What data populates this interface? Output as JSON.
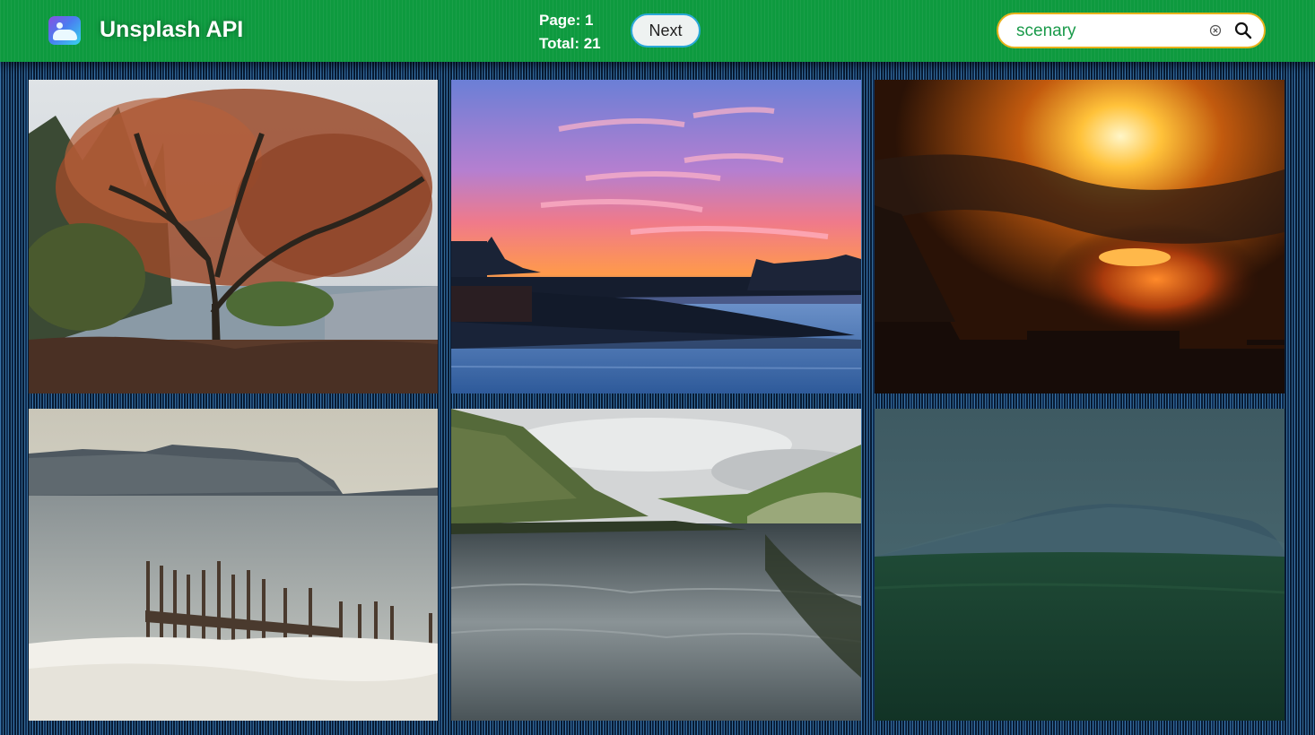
{
  "header": {
    "title": "Unsplash API",
    "page_label": "Page: 1",
    "total_label": "Total: 21",
    "next_label": "Next",
    "logo_icon": "gallery-image-icon",
    "background_color": "#0e9a3f"
  },
  "search": {
    "value": "scenary",
    "clear_icon": "clear-circle-icon",
    "search_icon": "magnifier-icon",
    "border_color": "#e8b21c",
    "text_color": "#1a9a4a"
  },
  "photos": [
    {
      "subject": "autumn tree with rust-colored leaves on a hillside"
    },
    {
      "subject": "pink and orange sunset over a calm harbor with silhouetted houses"
    },
    {
      "subject": "dark clouds with glowing orange sun behind silhouetted rooftop"
    },
    {
      "subject": "old wooden pier with birds on posts, snowy shore and mountains"
    },
    {
      "subject": "still river between green shrubs under a cloudy sky"
    },
    {
      "subject": "misty green hills under a foggy blue-gray sky"
    }
  ]
}
